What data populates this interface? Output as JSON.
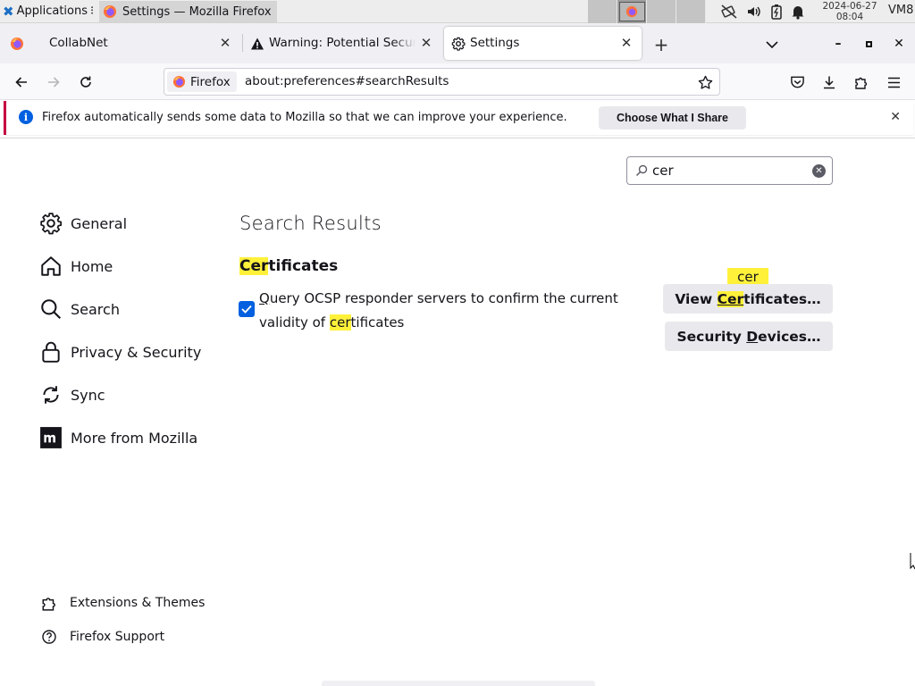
{
  "os_panel": {
    "applications_label": "Applications",
    "window_task_title": "Settings — Mozilla Firefox",
    "clock_date": "2024-06-27",
    "clock_time": "08:04",
    "vm_label": "VM8"
  },
  "tabs": [
    {
      "title": "CollabNet",
      "selected": false
    },
    {
      "title": "Warning: Potential Security Risk Ahead",
      "selected": false
    },
    {
      "title": "Settings",
      "selected": true
    }
  ],
  "urlbar": {
    "identity_label": "Firefox",
    "url": "about:preferences#searchResults"
  },
  "notification": {
    "message": "Firefox automatically sends some data to Mozilla so that we can improve your experience.",
    "button_label": "Choose What I Share"
  },
  "search": {
    "value": "cer"
  },
  "sidebar": {
    "categories": [
      {
        "label": "General",
        "icon": "gear-icon"
      },
      {
        "label": "Home",
        "icon": "home-icon"
      },
      {
        "label": "Search",
        "icon": "search-icon"
      },
      {
        "label": "Privacy & Security",
        "icon": "lock-icon"
      },
      {
        "label": "Sync",
        "icon": "sync-icon"
      },
      {
        "label": "More from Mozilla",
        "icon": "mozilla-icon"
      }
    ],
    "footer": [
      {
        "label": "Extensions & Themes",
        "icon": "puzzle-icon"
      },
      {
        "label": "Firefox Support",
        "icon": "help-icon"
      }
    ]
  },
  "results": {
    "title": "Search Results",
    "section_heading_hl": "Cer",
    "section_heading_rest": "tificates",
    "ocsp": {
      "checked": true,
      "label_underlined": "Q",
      "label_part1": "uery OCSP responder servers to confirm the current validity of ",
      "label_hl": "cer",
      "label_part2": "tificates"
    },
    "view_certs": {
      "part1": "View ",
      "hl": "Cer",
      "part2": "tificates…"
    },
    "security_devices": {
      "part1": "Security ",
      "underlined": "D",
      "part2": "evices…"
    },
    "tooltip": "cer"
  },
  "colors": {
    "accent": "#0060df",
    "highlight": "#fff13a",
    "notification_border": "#c50042"
  }
}
